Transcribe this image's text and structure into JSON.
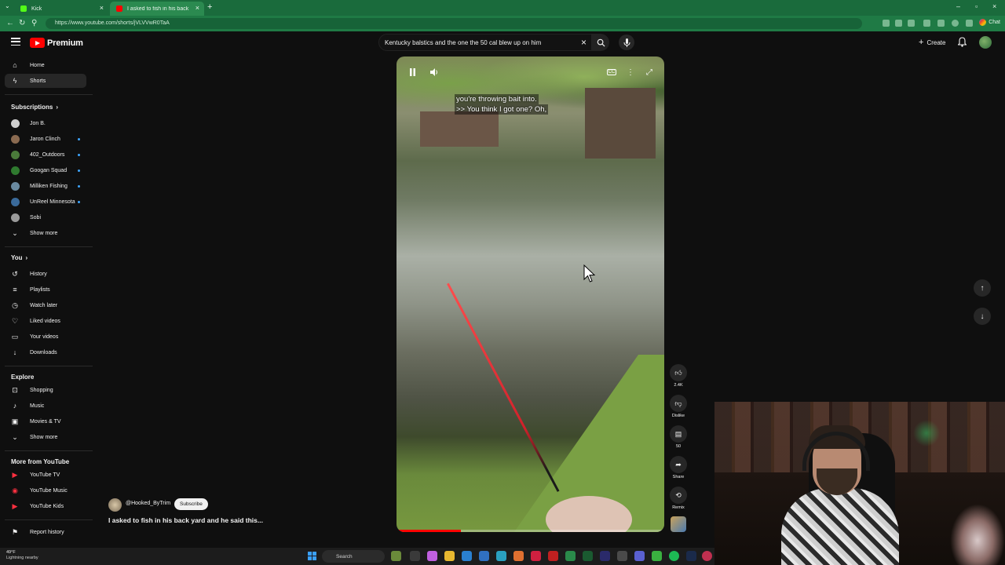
{
  "browser": {
    "tabs": [
      {
        "label": "Kick",
        "active": false,
        "color": "#53fc18"
      },
      {
        "label": "I asked to fish in his back yard",
        "active": true,
        "color": "#ff0000"
      }
    ],
    "url": "https://www.youtube.com/shorts/jVLVVwR0TaA",
    "chat_label": "Chat"
  },
  "masthead": {
    "logo_text": "Premium",
    "search_query": "Kentucky balstics and the one the 50 cal blew up on him",
    "create_label": "Create"
  },
  "sidebar": {
    "top": [
      {
        "label": "Home",
        "icon": "home-icon",
        "active": false
      },
      {
        "label": "Shorts",
        "icon": "shorts-icon",
        "active": true
      }
    ],
    "subscriptions_title": "Subscriptions",
    "subscriptions": [
      {
        "label": "Jon B.",
        "live": false
      },
      {
        "label": "Jaron Clinch",
        "live": true
      },
      {
        "label": "402_Outdoors",
        "live": true
      },
      {
        "label": "Googan Squad",
        "live": true
      },
      {
        "label": "Milliken Fishing",
        "live": true
      },
      {
        "label": "UnReel Minnesota",
        "live": true
      },
      {
        "label": "Sobi",
        "live": false
      }
    ],
    "show_more": "Show more",
    "you_title": "You",
    "you_items": [
      {
        "label": "History",
        "icon": "history-icon"
      },
      {
        "label": "Playlists",
        "icon": "playlists-icon"
      },
      {
        "label": "Watch later",
        "icon": "watch-later-icon"
      },
      {
        "label": "Liked videos",
        "icon": "liked-icon"
      },
      {
        "label": "Your videos",
        "icon": "your-videos-icon"
      },
      {
        "label": "Downloads",
        "icon": "download-icon"
      }
    ],
    "explore_title": "Explore",
    "explore_items": [
      {
        "label": "Shopping",
        "icon": "shopping-icon"
      },
      {
        "label": "Music",
        "icon": "music-icon"
      },
      {
        "label": "Movies & TV",
        "icon": "movies-icon"
      }
    ],
    "explore_more": "Show more",
    "more_title": "More from YouTube",
    "more_items": [
      {
        "label": "YouTube TV"
      },
      {
        "label": "YouTube Music"
      },
      {
        "label": "YouTube Kids"
      }
    ],
    "report_label": "Report history"
  },
  "video": {
    "caption_lines": [
      "you're throwing bait into.",
      ">> You think I got one? Oh,"
    ],
    "progress": 0.24
  },
  "actions": {
    "like_count": "2.4K",
    "dislike_label": "Dislike",
    "comment_count": "50",
    "share_label": "Share",
    "remix_label": "Remix"
  },
  "channel": {
    "handle": "@Hooked_ByTrim",
    "subscribe_label": "Subscribe",
    "title": "I asked to fish in his back yard and he said this..."
  },
  "taskbar": {
    "weather_temp": "49°F",
    "weather_desc": "Lightning nearby",
    "search_label": "Search"
  },
  "colors": {
    "accent": "#ff0000",
    "background": "#0f0f0f",
    "browser_chrome": "#1f7a45"
  }
}
